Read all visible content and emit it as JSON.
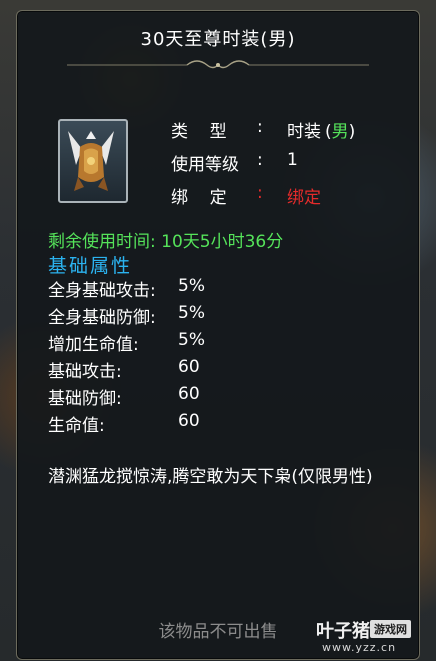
{
  "item": {
    "title": "30天至尊时装(男)",
    "icon": "winged-armor-icon",
    "properties": [
      {
        "label": "类    型",
        "colon": ":",
        "value": "时装",
        "extra_open": "(",
        "extra": "男",
        "extra_close": ")"
      },
      {
        "label": "使用等级",
        "colon": ":",
        "value": "1"
      },
      {
        "label": "绑    定",
        "colon": ":",
        "value": "绑定"
      }
    ],
    "remaining_time": "剩余使用时间: 10天5小时36分",
    "section_title": "基础属性",
    "stats": [
      {
        "label": "全身基础攻击:",
        "value": "5%"
      },
      {
        "label": "全身基础防御:",
        "value": "5%"
      },
      {
        "label": "增加生命值:",
        "value": "5%"
      },
      {
        "label": "基础攻击:",
        "value": "60"
      },
      {
        "label": "基础防御:",
        "value": "60"
      },
      {
        "label": "生命值:",
        "value": "60"
      }
    ],
    "description": "潜渊猛龙搅惊涛,腾空敢为天下枭(仅限男性)",
    "unsellable_note": "该物品不可出售"
  },
  "watermark": {
    "name": "叶子猪",
    "badge": "游戏网",
    "url": "www.yzz.cn"
  },
  "colors": {
    "value_green": "#55e35a",
    "bound_red": "#e52b2b",
    "section_blue": "#2bb3f0",
    "unsellable_gray": "#8c8c8c"
  }
}
